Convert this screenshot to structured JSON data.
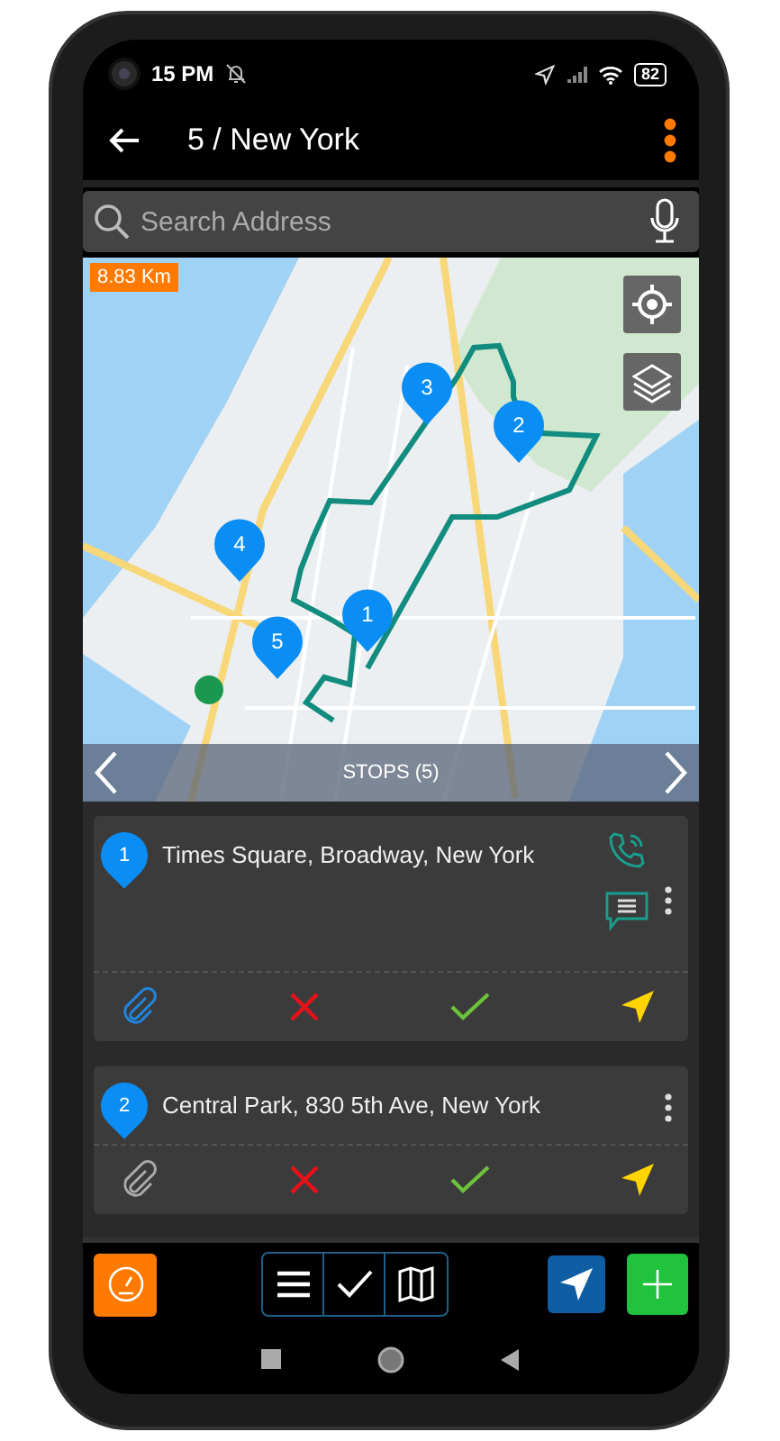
{
  "status_bar": {
    "time": "15 PM",
    "battery": "82"
  },
  "app_bar": {
    "title": "5 / New York"
  },
  "search": {
    "placeholder": "Search Address"
  },
  "map": {
    "distance": "8.83 Km",
    "stops_label": "STOPS (5)",
    "markers": [
      {
        "label": "1"
      },
      {
        "label": "2"
      },
      {
        "label": "3"
      },
      {
        "label": "4"
      },
      {
        "label": "5"
      }
    ]
  },
  "stops": [
    {
      "number": "1",
      "address": "Times Square, Broadway, New York",
      "has_contact": true,
      "has_attachment": true
    },
    {
      "number": "2",
      "address": "Central Park, 830 5th Ave, New York",
      "has_contact": false,
      "has_attachment": false
    }
  ],
  "view_tabs": [
    {
      "kind": "list"
    },
    {
      "kind": "check"
    },
    {
      "kind": "map"
    }
  ]
}
